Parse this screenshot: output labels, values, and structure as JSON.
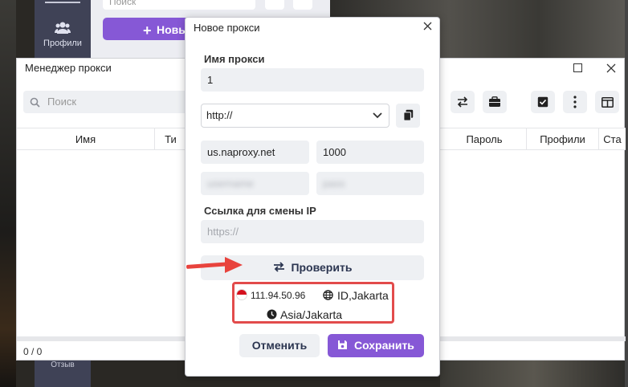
{
  "app": {
    "sidebar": {
      "profiles_label": "Профили",
      "profiles_icon": "users-icon",
      "feedback_label": "Отзыв"
    },
    "search_placeholder": "Поиск",
    "new_button": "Новый",
    "new_button_icon": "plus-icon",
    "accent_color": "#8658d6"
  },
  "proxy_manager": {
    "title": "Менеджер прокси",
    "search_placeholder": "Поиск",
    "columns": [
      "Имя",
      "Ти",
      "Пароль",
      "Профили",
      "Ста"
    ],
    "toolbar_icons": [
      "swap-icon",
      "briefcase-icon",
      "check-square-icon",
      "more-vertical-icon",
      "layout-icon"
    ],
    "footer_count": "0 / 0"
  },
  "dialog": {
    "title": "Новое прокси",
    "name_label": "Имя прокси",
    "name_value": "1",
    "protocol_value": "http://",
    "host_value": "us.naproxy.net",
    "port_value": "1000",
    "username_value": "username",
    "password_value": "pass",
    "ip_change_label": "Ссылка для смены IP",
    "ip_change_placeholder": "https://",
    "check_button": "Проверить",
    "result": {
      "ip": "111.94.50.96",
      "location": "ID,Jakarta",
      "timezone": "Asia/Jakarta"
    },
    "cancel_button": "Отменить",
    "save_button": "Сохранить"
  }
}
